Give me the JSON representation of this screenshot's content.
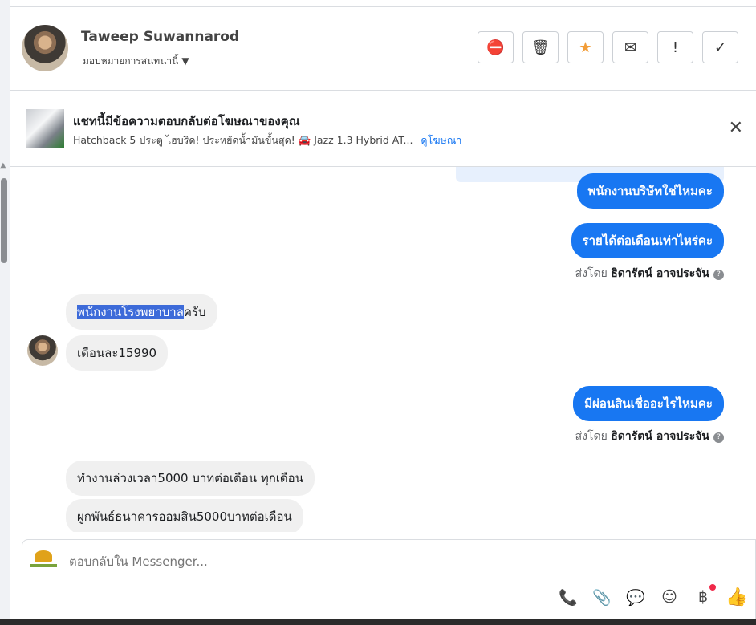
{
  "header": {
    "name": "Taweep Suwannarod",
    "assign_label": "มอบหมายการสนทนานี้",
    "actions": [
      {
        "icon": "spam-icon",
        "glyph": "⛔"
      },
      {
        "icon": "trash-icon",
        "glyph": "🗑"
      },
      {
        "icon": "star-icon",
        "glyph": "★"
      },
      {
        "icon": "mail-icon",
        "glyph": "✉"
      },
      {
        "icon": "follow-up-icon",
        "glyph": "!"
      },
      {
        "icon": "done-icon",
        "glyph": "✓"
      }
    ]
  },
  "ad": {
    "title": "แชทนี้มีข้อความตอบกลับต่อโฆษณาของคุณ",
    "subtitle": "Hatchback 5 ประตู ไฮบริด! ประหยัดน้ำมันขั้นสุด! 🚘 Jazz 1.3 Hybrid AT...",
    "link": "ดูโฆษณา",
    "close_glyph": "✕"
  },
  "messages": {
    "out1": "พนักงานบริษัทใช่ไหมคะ",
    "out2": "รายได้ต่อเดือนเท่าไหร่คะ",
    "sent_by_prefix": "ส่งโดย",
    "sent_by_name": "ธิดารัตน์ อาจประจัน",
    "in1_highlight": "พนักงานโรงพยาบาล",
    "in1_rest": "ครับ",
    "in2": "เดือนละ15990",
    "out3": "มีผ่อนสินเชื่ออะไรไหมคะ",
    "in3": "ทำงานล่วงเวลา5000 บาทต่อเดือน ทุกเดือน",
    "in4": "ผูกพันธ์ธนาคารออมสิน5000บาทต่อเดือน"
  },
  "composer": {
    "placeholder": "ตอบกลับใน Messenger...",
    "tools": [
      {
        "icon": "call-add-icon",
        "glyph": "📞"
      },
      {
        "icon": "attachment-icon",
        "glyph": "📎"
      },
      {
        "icon": "saved-reply-icon",
        "glyph": "💬"
      },
      {
        "icon": "emoji-icon",
        "glyph": "☺"
      },
      {
        "icon": "payment-baht-icon",
        "glyph": "฿"
      },
      {
        "icon": "like-icon",
        "glyph": "👍"
      }
    ]
  },
  "colors": {
    "accent": "#1877f2",
    "highlight": "#3d6bd9",
    "incoming_bubble": "#f0f0f0"
  }
}
